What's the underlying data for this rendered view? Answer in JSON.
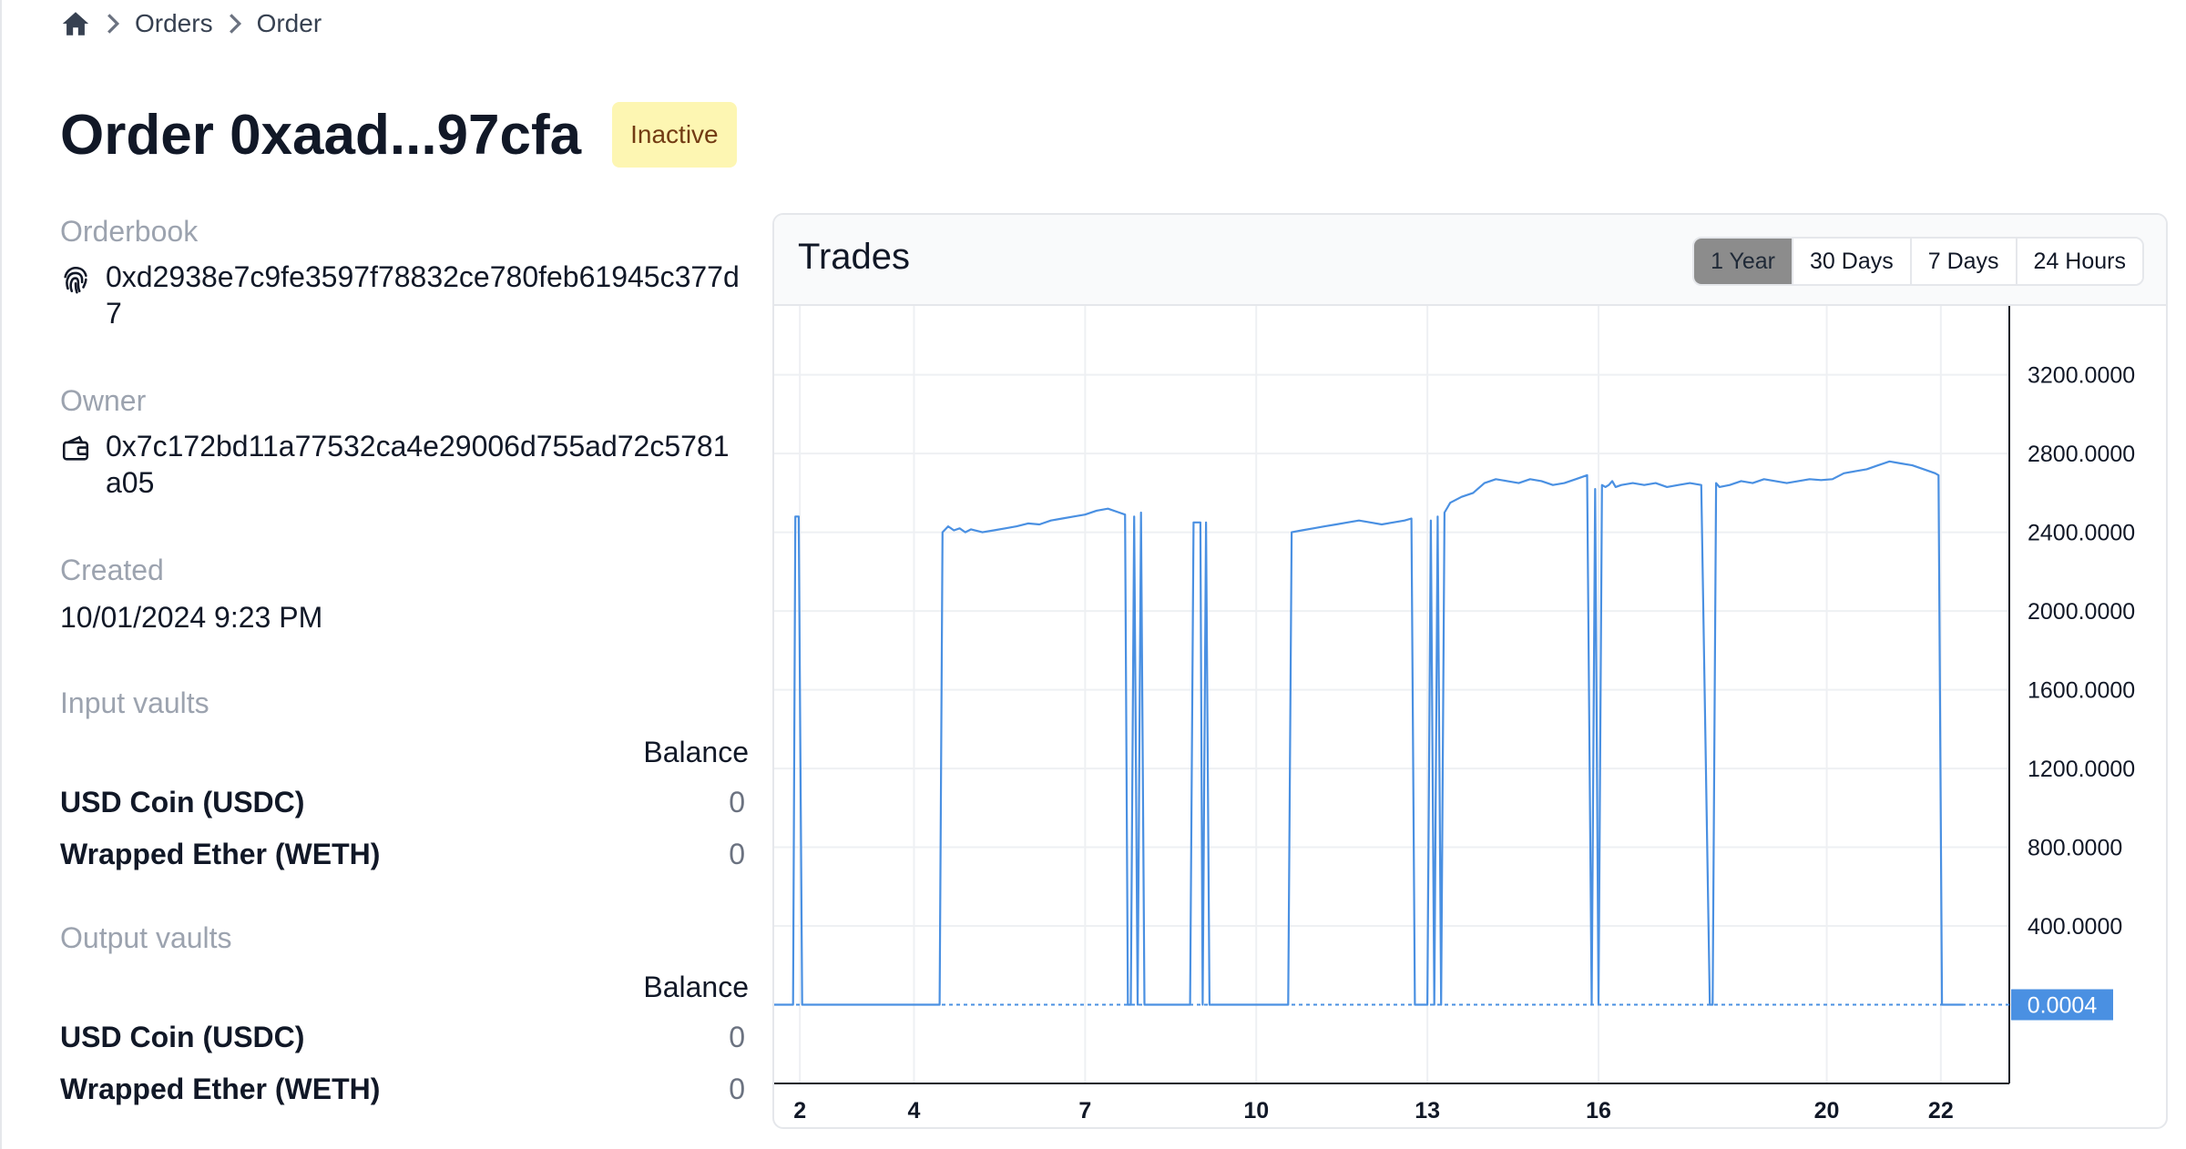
{
  "breadcrumb": {
    "home_icon": "home-icon",
    "items": [
      "Orders",
      "Order"
    ]
  },
  "title": {
    "prefix": "Order",
    "hash": "0xaad...97cfa",
    "status": "Inactive",
    "status_color": "#fdf6b2"
  },
  "details": {
    "orderbook_label": "Orderbook",
    "orderbook_value": "0xd2938e7c9fe3597f78832ce780feb61945c377d7",
    "orderbook_icon": "fingerprint-icon",
    "owner_label": "Owner",
    "owner_value": "0x7c172bd11a77532ca4e29006d755ad72c5781a05",
    "owner_icon": "wallet-icon",
    "created_label": "Created",
    "created_value": "10/01/2024 9:23 PM"
  },
  "input_vaults": {
    "label": "Input vaults",
    "balance_header": "Balance",
    "rows": [
      {
        "name": "USD Coin (USDC)",
        "balance": "0"
      },
      {
        "name": "Wrapped Ether (WETH)",
        "balance": "0"
      }
    ]
  },
  "output_vaults": {
    "label": "Output vaults",
    "balance_header": "Balance",
    "rows": [
      {
        "name": "USD Coin (USDC)",
        "balance": "0"
      },
      {
        "name": "Wrapped Ether (WETH)",
        "balance": "0"
      }
    ]
  },
  "chart_card": {
    "title": "Trades",
    "ranges": [
      "1 Year",
      "30 Days",
      "7 Days",
      "24 Hours"
    ],
    "active_range": "1 Year"
  },
  "chart_data": {
    "type": "line",
    "x_tick_labels": [
      "2",
      "4",
      "7",
      "10",
      "13",
      "16",
      "20",
      "22"
    ],
    "x_tick_positions": [
      2.0,
      4.0,
      7.0,
      10.0,
      13.0,
      16.0,
      20.0,
      22.0
    ],
    "y_tick_labels": [
      "400.0000",
      "800.0000",
      "1200.0000",
      "1600.0000",
      "2000.0000",
      "2400.0000",
      "2800.0000",
      "3200.0000"
    ],
    "ylim": [
      -400,
      3550
    ],
    "xlim": [
      1.55,
      23.2
    ],
    "y_axis_side": "right",
    "last_value_label": "0.0004",
    "last_value": 0.0004,
    "line_color": "#4a90e2",
    "grid": true,
    "series": [
      {
        "x": [
          1.5,
          1.88,
          1.92,
          1.98,
          2.04,
          2.1,
          4.45,
          4.5,
          4.6,
          4.7,
          4.8,
          4.9,
          5.0,
          5.2,
          5.4,
          5.6,
          5.8,
          6.0,
          6.2,
          6.4,
          6.6,
          6.8,
          7.0,
          7.2,
          7.4,
          7.6,
          7.7,
          7.75,
          7.8,
          7.86,
          7.92,
          7.98,
          8.04,
          8.84,
          8.9,
          9.02,
          9.06,
          9.12,
          9.18,
          9.26,
          10.56,
          10.62,
          10.8,
          11.0,
          11.2,
          11.4,
          11.6,
          11.8,
          12.0,
          12.2,
          12.4,
          12.6,
          12.72,
          12.78,
          13.0,
          13.06,
          13.12,
          13.18,
          13.24,
          13.3,
          13.36,
          13.4,
          13.6,
          13.8,
          14.0,
          14.2,
          14.4,
          14.6,
          14.8,
          15.0,
          15.2,
          15.4,
          15.6,
          15.8,
          15.88,
          15.94,
          16.0,
          16.06,
          16.12,
          16.18,
          16.24,
          16.3,
          16.4,
          16.6,
          16.8,
          17.0,
          17.2,
          17.4,
          17.6,
          17.8,
          17.95,
          18.0,
          18.06,
          18.12,
          18.3,
          18.5,
          18.7,
          18.9,
          19.1,
          19.3,
          19.5,
          19.7,
          19.9,
          20.1,
          20.3,
          20.5,
          20.7,
          20.9,
          21.1,
          21.3,
          21.5,
          21.7,
          21.9,
          21.96,
          22.02,
          22.4
        ],
        "y": [
          0.0004,
          0.0004,
          2480,
          2480,
          0.0004,
          0.0004,
          0.0004,
          2400,
          2430,
          2410,
          2420,
          2400,
          2415,
          2400,
          2410,
          2420,
          2430,
          2445,
          2440,
          2460,
          2470,
          2480,
          2490,
          2510,
          2520,
          2500,
          2490,
          0.0004,
          0.0004,
          2480,
          0.0004,
          2500,
          0.0004,
          0.0004,
          2450,
          2450,
          0.0004,
          2450,
          0.0004,
          0.0004,
          0.0004,
          2400,
          2410,
          2420,
          2430,
          2440,
          2450,
          2460,
          2450,
          2440,
          2450,
          2460,
          2470,
          0.0004,
          0.0004,
          2460,
          0.0004,
          2480,
          0.0004,
          2500,
          2530,
          2550,
          2580,
          2600,
          2650,
          2670,
          2660,
          2650,
          2670,
          2660,
          2640,
          2650,
          2670,
          2690,
          0.0004,
          2620,
          0.0004,
          2640,
          2630,
          2640,
          2660,
          2630,
          2640,
          2650,
          2640,
          2650,
          2630,
          2640,
          2650,
          2640,
          0.0004,
          0.0004,
          2650,
          2630,
          2640,
          2660,
          2650,
          2670,
          2660,
          2650,
          2660,
          2670,
          2665,
          2670,
          2700,
          2710,
          2720,
          2740,
          2760,
          2750,
          2740,
          2720,
          2700,
          2690,
          0.0004,
          0.0004
        ]
      }
    ]
  }
}
